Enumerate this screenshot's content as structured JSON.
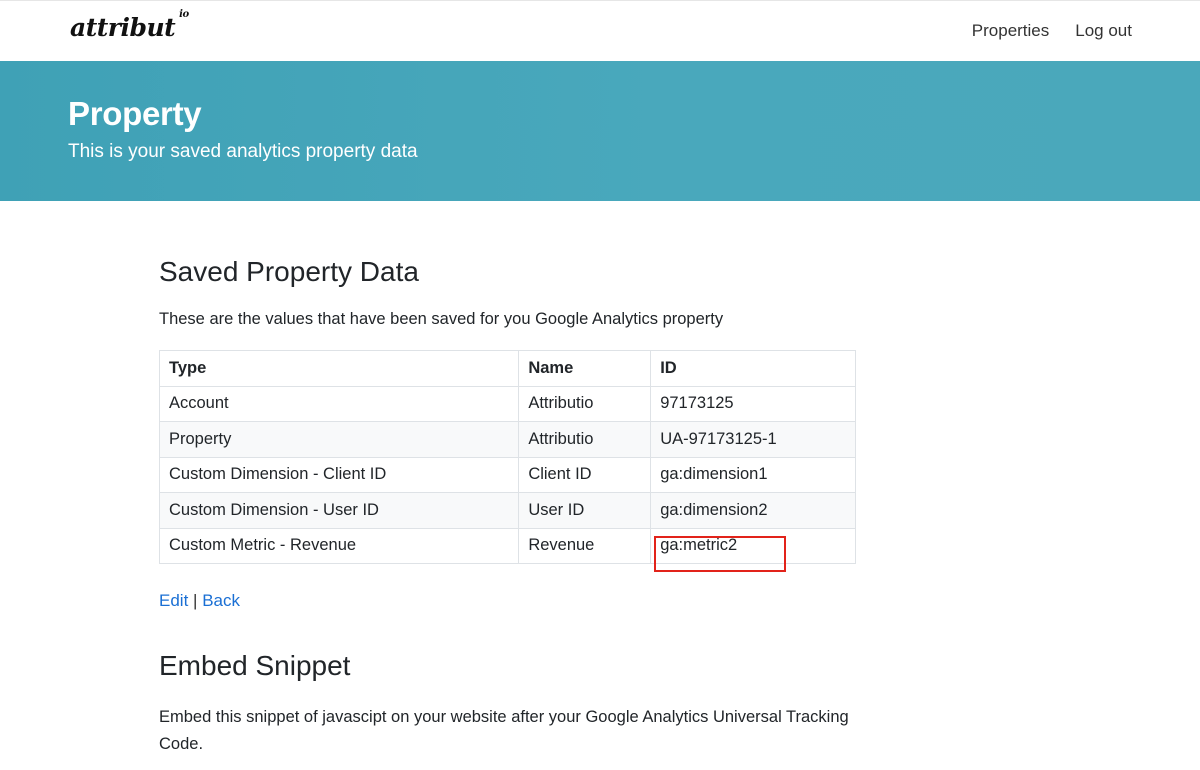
{
  "header": {
    "logo_text": "attribut",
    "logo_suffix": "io",
    "nav": [
      {
        "label": "Properties"
      },
      {
        "label": "Log out"
      }
    ]
  },
  "hero": {
    "title": "Property",
    "subtitle": "This is your saved analytics property data"
  },
  "saved": {
    "heading": "Saved Property Data",
    "description": "These are the values that have been saved for you Google Analytics property",
    "columns": [
      "Type",
      "Name",
      "ID"
    ],
    "rows": [
      [
        "Account",
        "Attributio",
        "97173125"
      ],
      [
        "Property",
        "Attributio",
        "UA-97173125-1"
      ],
      [
        "Custom Dimension - Client ID",
        "Client ID",
        "ga:dimension1"
      ],
      [
        "Custom Dimension - User ID",
        "User ID",
        "ga:dimension2"
      ],
      [
        "Custom Metric - Revenue",
        "Revenue",
        "ga:metric2"
      ]
    ],
    "edit_label": "Edit",
    "separator": "|",
    "back_label": "Back"
  },
  "embed": {
    "heading": "Embed Snippet",
    "description": "Embed this snippet of javascipt on your website after your Google Analytics Universal Tracking Code."
  },
  "colors": {
    "hero_bg": "#45a6ba",
    "link": "#1a6fd4",
    "highlight_border": "#e2231a"
  }
}
